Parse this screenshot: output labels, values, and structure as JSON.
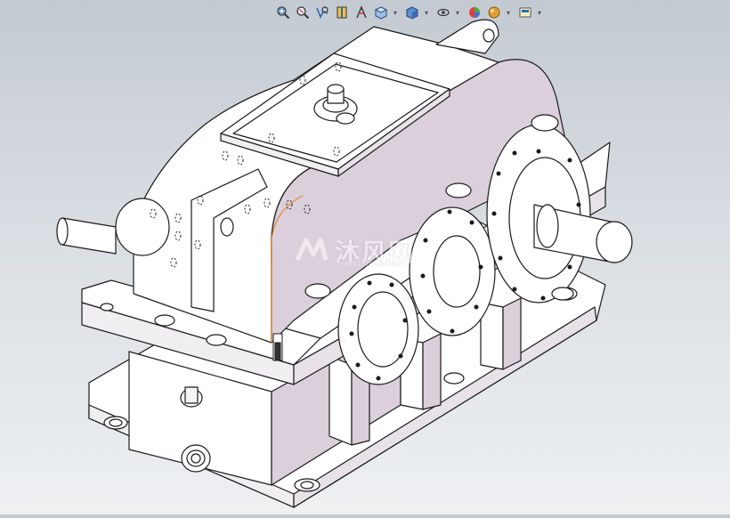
{
  "toolbar": {
    "items": [
      {
        "name": "zoom-to-fit-icon"
      },
      {
        "name": "zoom-to-area-icon"
      },
      {
        "name": "previous-view-icon"
      },
      {
        "name": "section-view-icon"
      },
      {
        "name": "dynamic-annotation-icon"
      },
      {
        "name": "view-orientation-icon",
        "dropdown": true
      },
      {
        "name": "display-style-icon",
        "dropdown": true
      },
      {
        "name": "hide-show-items-icon",
        "dropdown": true
      },
      {
        "name": "edit-appearance-icon"
      },
      {
        "name": "apply-scene-icon",
        "dropdown": true
      },
      {
        "name": "view-settings-icon",
        "dropdown": true
      }
    ],
    "dropdown_glyph": "▾"
  },
  "model": {
    "type": "gear-reducer-assembly",
    "colors": {
      "body": "#ffffff",
      "housing_side": "#dccfdc",
      "edge": "#1a1a1a"
    }
  },
  "watermark": {
    "text": "沐风网",
    "url": "www.mfcad.com"
  }
}
